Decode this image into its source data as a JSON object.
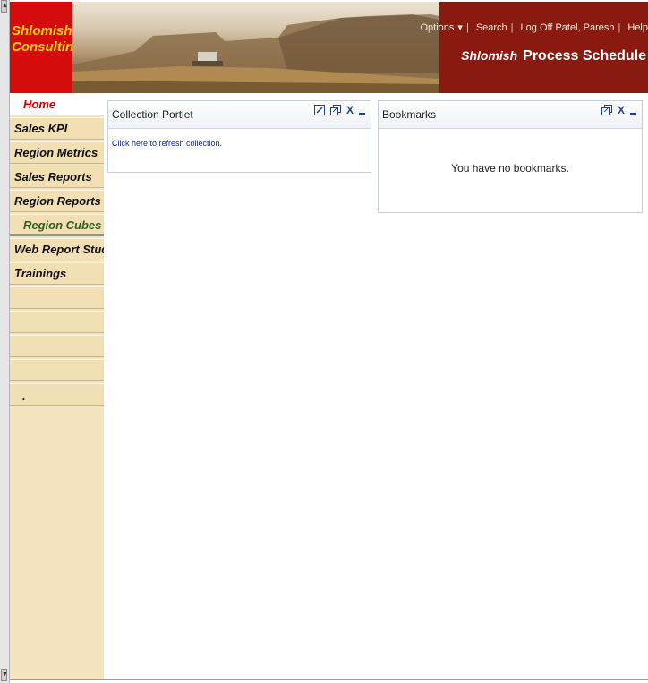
{
  "header": {
    "logo_line1": "Shlomish",
    "logo_line2": "Consulting",
    "nav": {
      "options": "Options",
      "options_caret": "▾",
      "search": "Search",
      "logoff": "Log Off Patel, Paresh",
      "help": "Help"
    },
    "brand": "Shlomish",
    "app_title": "Process Schedule"
  },
  "sidebar": {
    "items": [
      {
        "label": "Home"
      },
      {
        "label": "Sales KPI"
      },
      {
        "label": "Region Metrics"
      },
      {
        "label": "Sales Reports"
      },
      {
        "label": "Region Reports"
      },
      {
        "label": "Region Cubes"
      },
      {
        "label": "Web Report Studio"
      },
      {
        "label": "Trainings"
      },
      {
        "label": ""
      },
      {
        "label": ""
      },
      {
        "label": ""
      },
      {
        "label": ""
      },
      {
        "label": "."
      }
    ]
  },
  "collection_portlet": {
    "title": "Collection Portlet",
    "link": "Click here to refresh collection.",
    "close": "X"
  },
  "bookmarks_portlet": {
    "title": "Bookmarks",
    "message": "You have no bookmarks.",
    "close": "X"
  },
  "colors": {
    "header_bg": "#8a1a10",
    "logo_bg": "#d50a0a",
    "logo_text": "#ffd400",
    "sidebar_bg": "#f5e4c0",
    "active_nav": "#d00000",
    "selected_nav": "#2d5f1a",
    "link": "#1a2f8a"
  }
}
